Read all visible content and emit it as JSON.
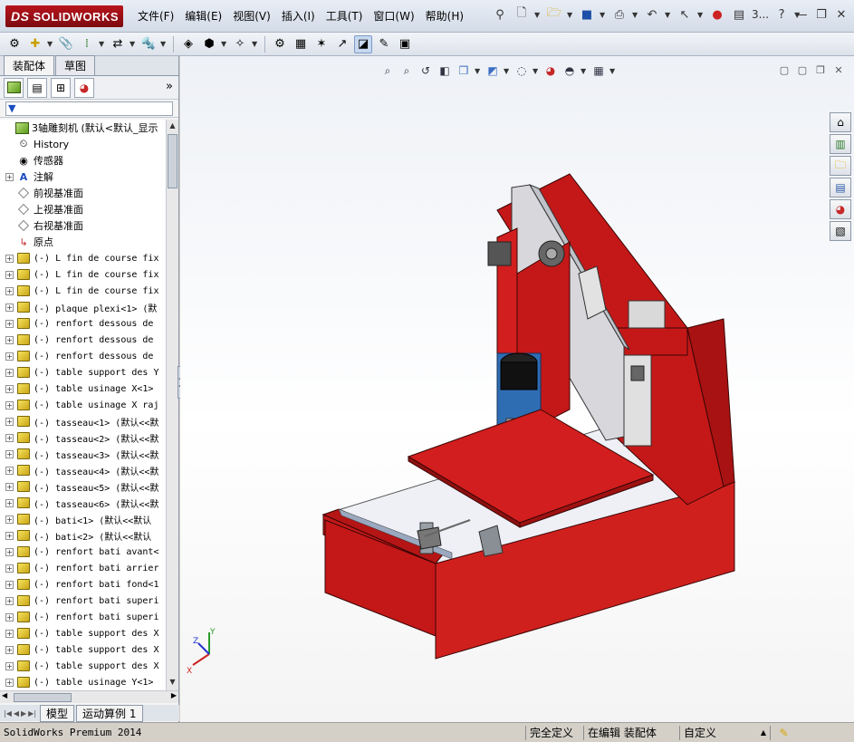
{
  "app": {
    "brand": "SOLIDWORKS",
    "brand_prefix": "DS"
  },
  "menu": [
    "文件(F)",
    "编辑(E)",
    "视图(V)",
    "插入(I)",
    "工具(T)",
    "窗口(W)",
    "帮助(H)"
  ],
  "title_doc": "3...",
  "panel_tabs": [
    "装配体",
    "草图"
  ],
  "tree": [
    {
      "label": "3轴雕刻机  (默认<默认_显示",
      "type": "root",
      "exp": "",
      "indent": 0
    },
    {
      "label": "History",
      "type": "history",
      "exp": "",
      "indent": 1
    },
    {
      "label": "传感器",
      "type": "sensor",
      "exp": "",
      "indent": 1
    },
    {
      "label": "注解",
      "type": "annot",
      "exp": "+",
      "indent": 1
    },
    {
      "label": "前视基准面",
      "type": "plane",
      "exp": "",
      "indent": 1
    },
    {
      "label": "上视基准面",
      "type": "plane",
      "exp": "",
      "indent": 1
    },
    {
      "label": "右视基准面",
      "type": "plane",
      "exp": "",
      "indent": 1
    },
    {
      "label": "原点",
      "type": "origin",
      "exp": "",
      "indent": 1
    },
    {
      "label": "(-) L fin de course fix",
      "type": "part",
      "exp": "+",
      "indent": 1
    },
    {
      "label": "(-) L fin de course fix",
      "type": "part",
      "exp": "+",
      "indent": 1
    },
    {
      "label": "(-) L fin de course fix",
      "type": "part",
      "exp": "+",
      "indent": 1
    },
    {
      "label": "(-) plaque plexi<1> (默",
      "type": "part",
      "exp": "+",
      "indent": 1
    },
    {
      "label": "(-) renfort dessous de",
      "type": "part",
      "exp": "+",
      "indent": 1
    },
    {
      "label": "(-) renfort dessous de",
      "type": "part",
      "exp": "+",
      "indent": 1
    },
    {
      "label": "(-) renfort dessous de",
      "type": "part",
      "exp": "+",
      "indent": 1
    },
    {
      "label": "(-) table support des Y",
      "type": "part",
      "exp": "+",
      "indent": 1
    },
    {
      "label": "(-) table usinage X<1>",
      "type": "part",
      "exp": "+",
      "indent": 1
    },
    {
      "label": "(-) table usinage X raj",
      "type": "part",
      "exp": "+",
      "indent": 1
    },
    {
      "label": "(-) tasseau<1> (默认<<默",
      "type": "part",
      "exp": "+",
      "indent": 1
    },
    {
      "label": "(-) tasseau<2> (默认<<默",
      "type": "part",
      "exp": "+",
      "indent": 1
    },
    {
      "label": "(-) tasseau<3> (默认<<默",
      "type": "part",
      "exp": "+",
      "indent": 1
    },
    {
      "label": "(-) tasseau<4> (默认<<默",
      "type": "part",
      "exp": "+",
      "indent": 1
    },
    {
      "label": "(-) tasseau<5> (默认<<默",
      "type": "part",
      "exp": "+",
      "indent": 1
    },
    {
      "label": "(-) tasseau<6> (默认<<默",
      "type": "part",
      "exp": "+",
      "indent": 1
    },
    {
      "label": "(-) bati<1> (默认<<默认",
      "type": "part",
      "exp": "+",
      "indent": 1
    },
    {
      "label": "(-) bati<2> (默认<<默认",
      "type": "part",
      "exp": "+",
      "indent": 1
    },
    {
      "label": "(-) renfort bati avant<",
      "type": "part",
      "exp": "+",
      "indent": 1
    },
    {
      "label": "(-) renfort bati arrier",
      "type": "part",
      "exp": "+",
      "indent": 1
    },
    {
      "label": "(-) renfort bati fond<1",
      "type": "part",
      "exp": "+",
      "indent": 1
    },
    {
      "label": "(-) renfort bati superi",
      "type": "part",
      "exp": "+",
      "indent": 1
    },
    {
      "label": "(-) renfort bati superi",
      "type": "part",
      "exp": "+",
      "indent": 1
    },
    {
      "label": "(-) table support des X",
      "type": "part",
      "exp": "+",
      "indent": 1
    },
    {
      "label": "(-) table support des X",
      "type": "part",
      "exp": "+",
      "indent": 1
    },
    {
      "label": "(-) table support des X",
      "type": "part",
      "exp": "+",
      "indent": 1
    },
    {
      "label": "(-) table usinage Y<1>",
      "type": "part",
      "exp": "+",
      "indent": 1
    }
  ],
  "bottom_tabs": [
    "模型",
    "运动算例 1"
  ],
  "status": {
    "product": "SolidWorks Premium 2014",
    "s1": "完全定义",
    "s2": "在编辑 装配体",
    "s3": "自定义"
  },
  "axes": {
    "x": "X",
    "y": "Y",
    "z": "Z"
  }
}
